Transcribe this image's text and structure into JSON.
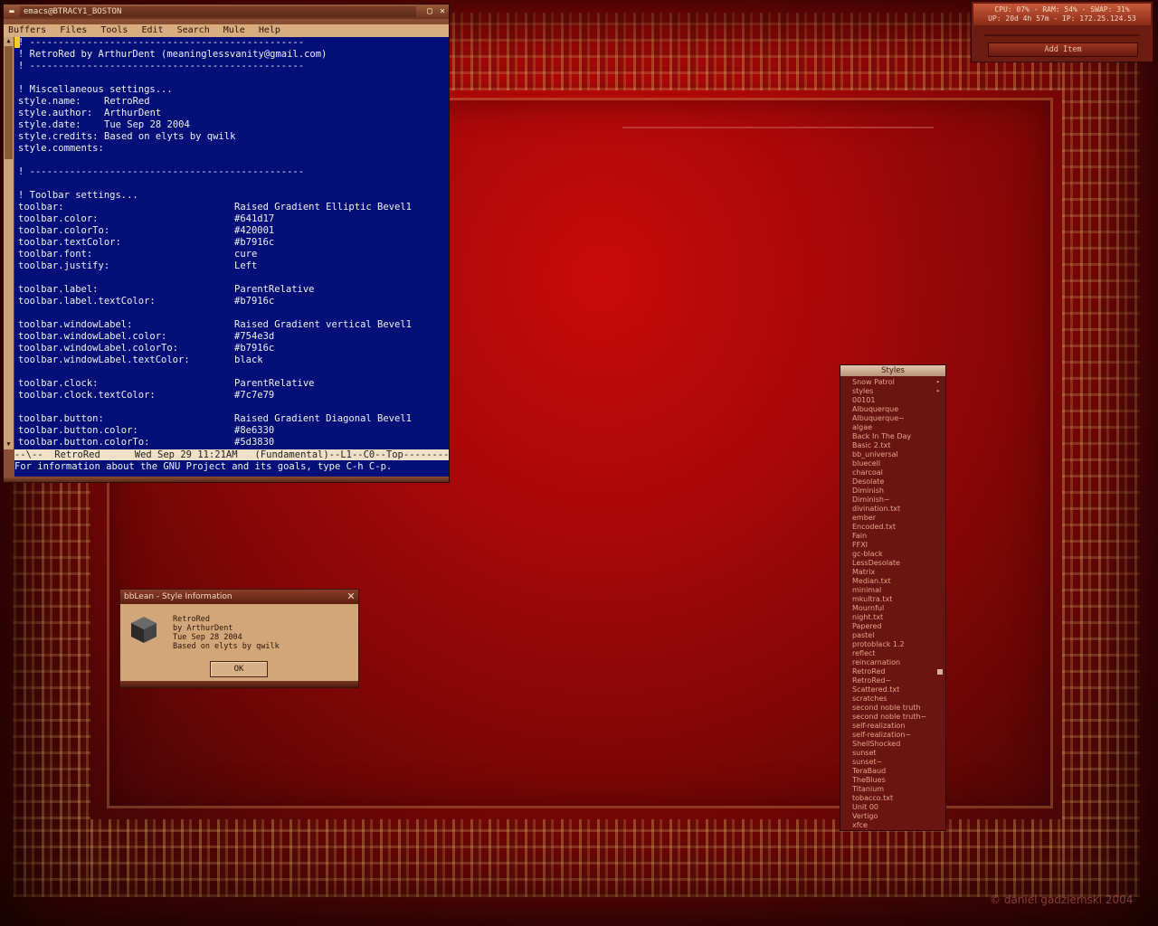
{
  "emacs": {
    "window_title": "emacs@BTRACY1_BOSTON",
    "menu": [
      "Buffers",
      "Files",
      "Tools",
      "Edit",
      "Search",
      "Mule",
      "Help"
    ],
    "lines": [
      {
        "k": "! ------------------------------------------------",
        "v": ""
      },
      {
        "k": "! RetroRed by ArthurDent (meaninglessvanity@gmail.com)",
        "v": ""
      },
      {
        "k": "! ------------------------------------------------",
        "v": ""
      },
      {
        "k": "",
        "v": ""
      },
      {
        "k": "! Miscellaneous settings...",
        "v": ""
      },
      {
        "k": "style.name:",
        "v2": "RetroRed"
      },
      {
        "k": "style.author:",
        "v2": "ArthurDent"
      },
      {
        "k": "style.date:",
        "v2": "Tue Sep 28 2004"
      },
      {
        "k": "style.credits:",
        "v2": "Based on elyts by qwilk"
      },
      {
        "k": "style.comments:",
        "v": ""
      },
      {
        "k": "",
        "v": ""
      },
      {
        "k": "! ------------------------------------------------",
        "v": ""
      },
      {
        "k": "",
        "v": ""
      },
      {
        "k": "! Toolbar settings...",
        "v": ""
      },
      {
        "k": "toolbar:",
        "v": "Raised Gradient Elliptic Bevel1"
      },
      {
        "k": "toolbar.color:",
        "v": "#641d17"
      },
      {
        "k": "toolbar.colorTo:",
        "v": "#420001"
      },
      {
        "k": "toolbar.textColor:",
        "v": "#b7916c"
      },
      {
        "k": "toolbar.font:",
        "v": "cure"
      },
      {
        "k": "toolbar.justify:",
        "v": "Left"
      },
      {
        "k": "",
        "v": ""
      },
      {
        "k": "toolbar.label:",
        "v": "ParentRelative"
      },
      {
        "k": "toolbar.label.textColor:",
        "v": "#b7916c"
      },
      {
        "k": "",
        "v": ""
      },
      {
        "k": "toolbar.windowLabel:",
        "v": "Raised Gradient vertical Bevel1"
      },
      {
        "k": "toolbar.windowLabel.color:",
        "v": "#754e3d"
      },
      {
        "k": "toolbar.windowLabel.colorTo:",
        "v": "#b7916c"
      },
      {
        "k": "toolbar.windowLabel.textColor:",
        "v": "black"
      },
      {
        "k": "",
        "v": ""
      },
      {
        "k": "toolbar.clock:",
        "v": "ParentRelative"
      },
      {
        "k": "toolbar.clock.textColor:",
        "v": "#7c7e79"
      },
      {
        "k": "",
        "v": ""
      },
      {
        "k": "toolbar.button:",
        "v": "Raised Gradient Diagonal Bevel1"
      },
      {
        "k": "toolbar.button.color:",
        "v": "#8e6330"
      },
      {
        "k": "toolbar.button.colorTo:",
        "v": "#5d3830"
      }
    ],
    "modeline": "--\\--  RetroRed      Wed Sep 29 11:21AM   (Fundamental)--L1--C0--Top-----------",
    "minibuffer": "For information about the GNU Project and its goals, type C-h C-p."
  },
  "sysmon": {
    "line1": "CPU: 07% - RAM: 54% - SWAP: 31%",
    "line2": "UP: 20d 4h 57m - IP: 172.25.124.53",
    "add_item": "Add Item"
  },
  "style_info": {
    "title": "bbLean - Style Information",
    "name": "RetroRed",
    "author": "by ArthurDent",
    "date": "Tue Sep 28 2004",
    "credits": "Based on elyts by qwilk",
    "ok": "OK"
  },
  "styles_menu": {
    "title": "Styles",
    "items": [
      {
        "label": "Snow Patrol",
        "submenu": true
      },
      {
        "label": "styles",
        "submenu": true
      },
      {
        "label": "00101"
      },
      {
        "label": "Albuquerque"
      },
      {
        "label": "Albuquerque~"
      },
      {
        "label": "algae"
      },
      {
        "label": "Back In The Day"
      },
      {
        "label": "Basic 2.txt"
      },
      {
        "label": "bb_universal"
      },
      {
        "label": "bluecell"
      },
      {
        "label": "charcoal"
      },
      {
        "label": "Desolate"
      },
      {
        "label": "Diminish"
      },
      {
        "label": "Diminish~"
      },
      {
        "label": "divination.txt"
      },
      {
        "label": "ember"
      },
      {
        "label": "Encoded.txt"
      },
      {
        "label": "Fain"
      },
      {
        "label": "FFXI"
      },
      {
        "label": "gc-black"
      },
      {
        "label": "LessDesolate"
      },
      {
        "label": "Matrix"
      },
      {
        "label": "Median.txt"
      },
      {
        "label": "minimal"
      },
      {
        "label": "mkultra.txt"
      },
      {
        "label": "Mournful"
      },
      {
        "label": "night.txt"
      },
      {
        "label": "Papered"
      },
      {
        "label": "pastel"
      },
      {
        "label": "protoblack 1.2"
      },
      {
        "label": "reflect"
      },
      {
        "label": "reincarnation"
      },
      {
        "label": "RetroRed",
        "selected": true
      },
      {
        "label": "RetroRed~"
      },
      {
        "label": "Scattered.txt"
      },
      {
        "label": "scratches"
      },
      {
        "label": "second noble truth"
      },
      {
        "label": "second noble truth~"
      },
      {
        "label": "self-realization"
      },
      {
        "label": "self-realization~"
      },
      {
        "label": "ShellShocked"
      },
      {
        "label": "sunset"
      },
      {
        "label": "sunset~"
      },
      {
        "label": "TeraBaud"
      },
      {
        "label": "TheBlues"
      },
      {
        "label": "Titanium"
      },
      {
        "label": "tobacco.txt"
      },
      {
        "label": "Unit 00"
      },
      {
        "label": "Vertigo"
      },
      {
        "label": "xfce"
      }
    ]
  },
  "copyright": "© daniel gadziemski 2004"
}
